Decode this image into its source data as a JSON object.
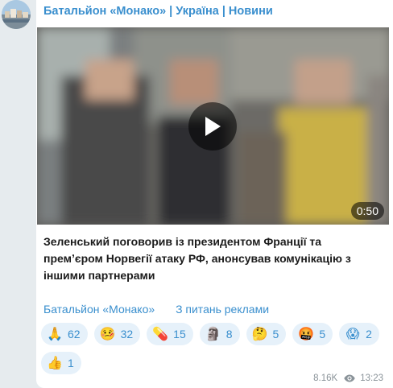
{
  "channel": {
    "title": "Батальйон «Монако» | Україна | Новини"
  },
  "video": {
    "duration": "0:50",
    "play_icon": "play-icon"
  },
  "post": {
    "caption": "Зеленський поговорив із президентом Франції та премʼєром Норвегії атаку РФ, анонсував комунікацію з іншими партнерами"
  },
  "links": {
    "channel_link": "Батальйон «Монако»",
    "ads_link": "З питань реклами"
  },
  "reactions": [
    {
      "emoji": "🙏",
      "count": "62"
    },
    {
      "emoji": "🤒",
      "count": "32"
    },
    {
      "emoji": "💊",
      "count": "15"
    },
    {
      "emoji": "🗿",
      "count": "8"
    },
    {
      "emoji": "🤔",
      "count": "5"
    },
    {
      "emoji": "🤬",
      "count": "5"
    },
    {
      "emoji": "😱",
      "count": "2"
    },
    {
      "emoji": "👍",
      "count": "1"
    }
  ],
  "meta": {
    "views": "8.16K",
    "time": "13:23"
  },
  "colors": {
    "accent": "#3a8fce",
    "reaction_bg": "#e6f1fa",
    "background": "#e6ebee"
  }
}
